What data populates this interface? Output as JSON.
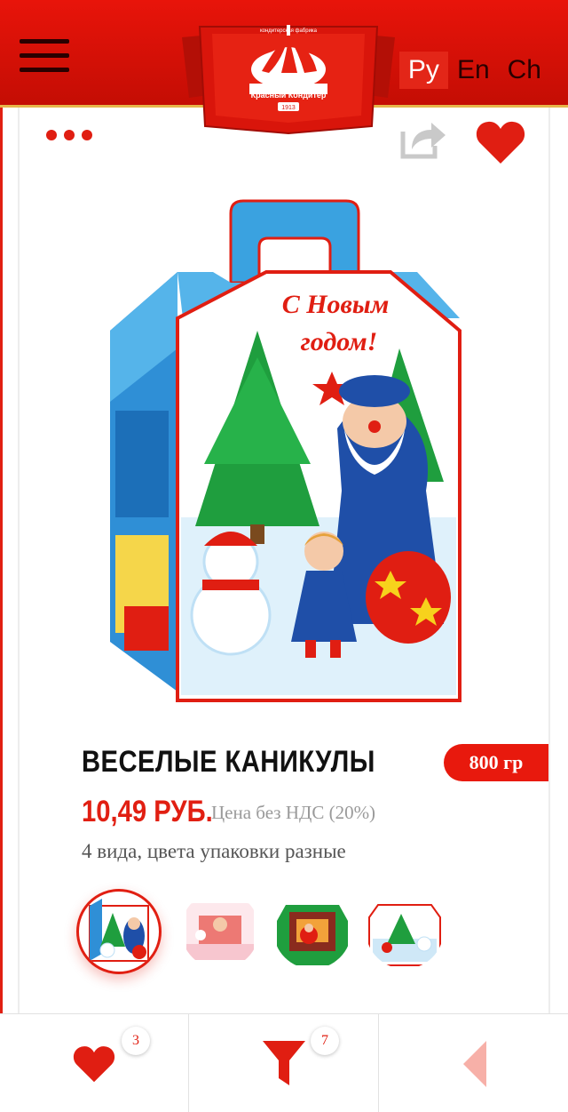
{
  "header": {
    "logo_alt": "Красный кондитер",
    "logo_text_top": "кондитерская фабрика",
    "logo_text_main": "Красный Кондитер",
    "logo_year": "1913",
    "languages": [
      "Ру",
      "En",
      "Ch"
    ],
    "active_language": "Ру"
  },
  "product": {
    "title": "ВЕСЕЛЫЕ КАНИКУЛЫ",
    "weight": "800 гр",
    "price": "10,49 РУБ.",
    "vat_note": "Цена без НДС (20%)",
    "description": "4 вида, цвета упаковки разные",
    "image_caption_1": "С Новым",
    "image_caption_2": "годом!"
  },
  "variants": [
    "variant-1",
    "variant-2",
    "variant-3",
    "variant-4"
  ],
  "bottom_bar": {
    "favorites_count": "3",
    "filter_count": "7"
  },
  "colors": {
    "brand_red": "#e11f12",
    "header_red": "#d8130a",
    "gold": "#e6b64a"
  },
  "icons": [
    "menu-icon",
    "more-icon",
    "share-icon",
    "heart-icon",
    "filter-icon",
    "arrow-left-icon"
  ]
}
